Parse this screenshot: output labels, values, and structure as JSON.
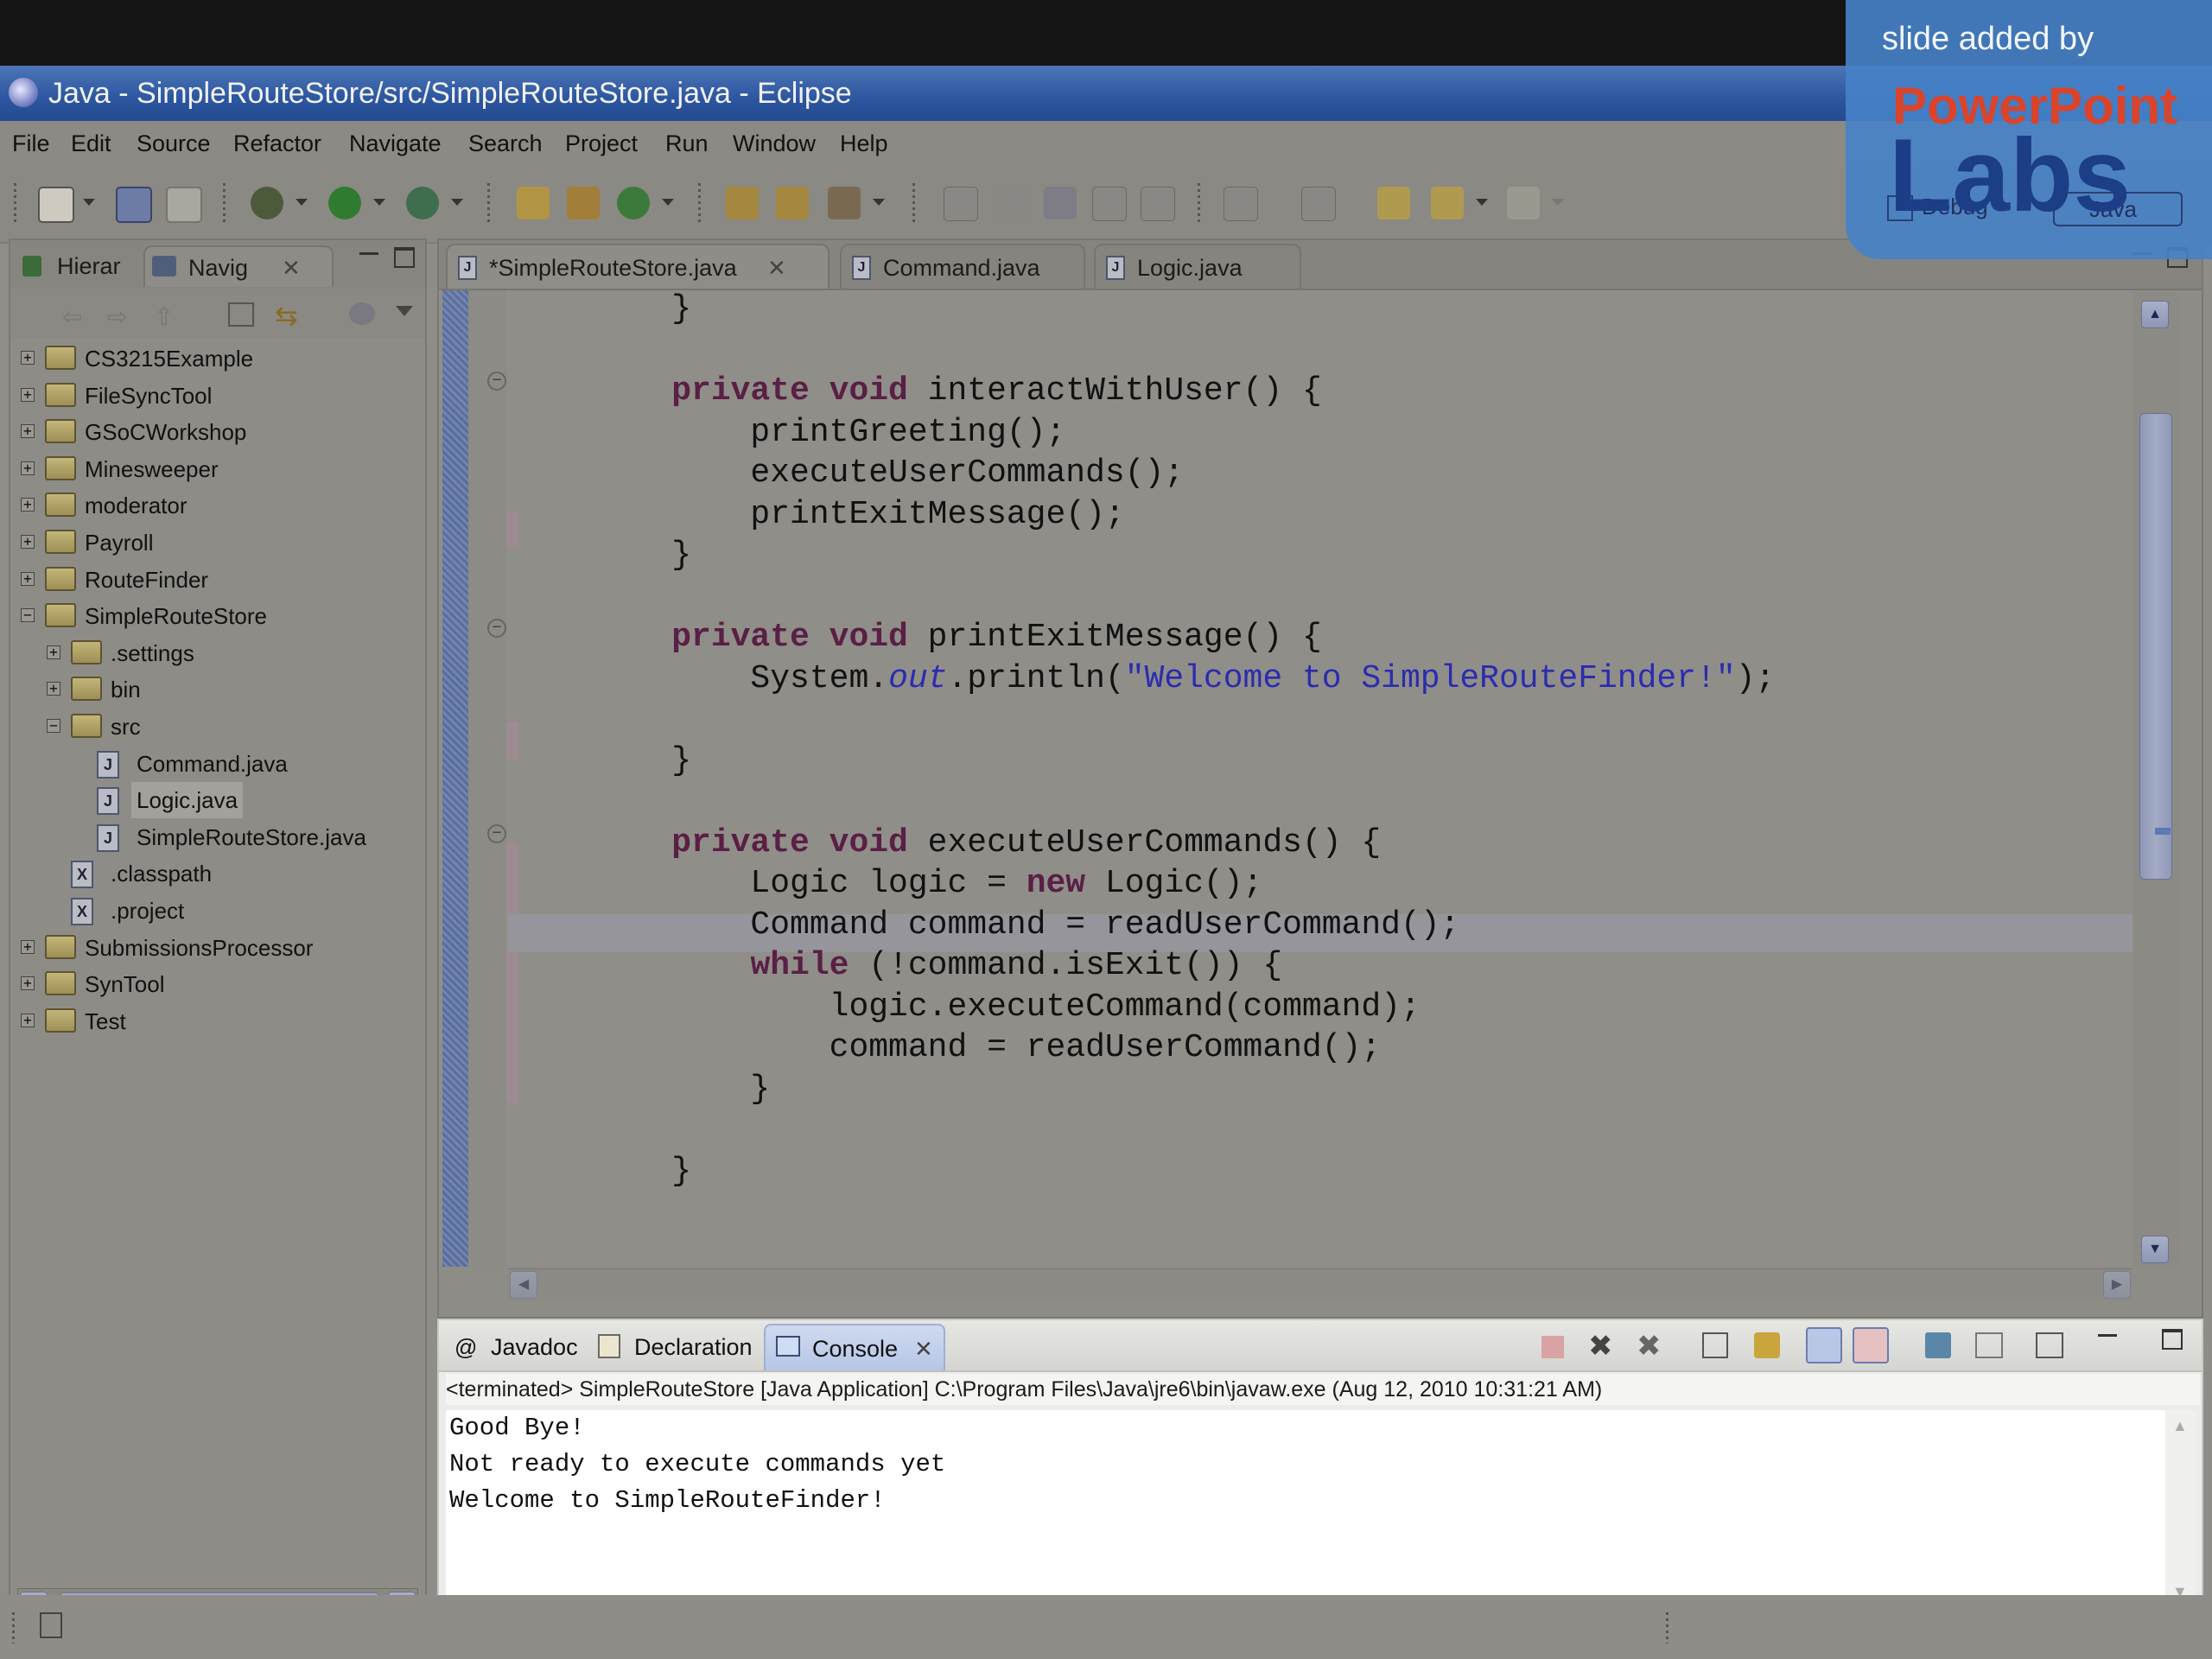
{
  "window": {
    "title": "Java - SimpleRouteStore/src/SimpleRouteStore.java - Eclipse"
  },
  "menu": [
    "File",
    "Edit",
    "Source",
    "Refactor",
    "Navigate",
    "Search",
    "Project",
    "Run",
    "Window",
    "Help"
  ],
  "left_panel": {
    "tabs": [
      {
        "label": "Hierar",
        "icon": "hierarchy-icon"
      },
      {
        "label": "Navig",
        "icon": "navigator-icon"
      }
    ],
    "tree": [
      {
        "label": "CS3215Example",
        "type": "project",
        "expanded": false
      },
      {
        "label": "FileSyncTool",
        "type": "project",
        "expanded": false
      },
      {
        "label": "GSoCWorkshop",
        "type": "project",
        "expanded": false
      },
      {
        "label": "Minesweeper",
        "type": "project",
        "expanded": false
      },
      {
        "label": "moderator",
        "type": "project",
        "expanded": false
      },
      {
        "label": "Payroll",
        "type": "project",
        "expanded": false
      },
      {
        "label": "RouteFinder",
        "type": "project",
        "expanded": false
      },
      {
        "label": "SimpleRouteStore",
        "type": "project",
        "expanded": true
      },
      {
        "label": ".settings",
        "type": "folder",
        "expanded": false
      },
      {
        "label": "bin",
        "type": "folder",
        "expanded": false
      },
      {
        "label": "src",
        "type": "folder",
        "expanded": true
      },
      {
        "label": "Command.java",
        "type": "java"
      },
      {
        "label": "Logic.java",
        "type": "java",
        "selected": true
      },
      {
        "label": "SimpleRouteStore.java",
        "type": "java"
      },
      {
        "label": ".classpath",
        "type": "xml"
      },
      {
        "label": ".project",
        "type": "xml"
      },
      {
        "label": "SubmissionsProcessor",
        "type": "project",
        "expanded": false
      },
      {
        "label": "SynTool",
        "type": "project",
        "expanded": false
      },
      {
        "label": "Test",
        "type": "project",
        "expanded": false
      }
    ]
  },
  "editor": {
    "tabs": [
      {
        "label": "*SimpleRouteStore.java",
        "active": true
      },
      {
        "label": "Command.java",
        "active": false
      },
      {
        "label": "Logic.java",
        "active": false
      }
    ],
    "code": [
      [
        {
          "t": "    }"
        }
      ],
      [
        {
          "t": ""
        }
      ],
      [
        {
          "t": "    "
        },
        {
          "t": "private void",
          "k": "kw"
        },
        {
          "t": " interactWithUser() {"
        }
      ],
      [
        {
          "t": "        printGreeting();"
        }
      ],
      [
        {
          "t": "        executeUserCommands();"
        }
      ],
      [
        {
          "t": "        printExitMessage();"
        }
      ],
      [
        {
          "t": "    }"
        }
      ],
      [
        {
          "t": ""
        }
      ],
      [
        {
          "t": "    "
        },
        {
          "t": "private void",
          "k": "kw"
        },
        {
          "t": " printExitMessage() {"
        }
      ],
      [
        {
          "t": "        System."
        },
        {
          "t": "out",
          "k": "fld"
        },
        {
          "t": ".println("
        },
        {
          "t": "\"Welcome to SimpleRouteFinder!\"",
          "k": "str"
        },
        {
          "t": ");"
        }
      ],
      [
        {
          "t": ""
        }
      ],
      [
        {
          "t": "    }"
        }
      ],
      [
        {
          "t": ""
        }
      ],
      [
        {
          "t": "    "
        },
        {
          "t": "private void",
          "k": "kw"
        },
        {
          "t": " executeUserCommands() {"
        }
      ],
      [
        {
          "t": "        Logic logic = "
        },
        {
          "t": "new",
          "k": "kw"
        },
        {
          "t": " Logic();"
        }
      ],
      [
        {
          "t": "        Command command = readUserCommand();"
        }
      ],
      [
        {
          "t": "        "
        },
        {
          "t": "while",
          "k": "kw"
        },
        {
          "t": " (!command.isExit()) {"
        }
      ],
      [
        {
          "t": "            logic.executeCommand(command);"
        }
      ],
      [
        {
          "t": "            command = readUserCommand();"
        }
      ],
      [
        {
          "t": "        }"
        }
      ],
      [
        {
          "t": ""
        }
      ],
      [
        {
          "t": "    }"
        }
      ]
    ]
  },
  "console": {
    "tabs": [
      {
        "label": "Javadoc",
        "icon": "at-icon"
      },
      {
        "label": "Declaration",
        "icon": "declaration-icon"
      },
      {
        "label": "Console",
        "icon": "console-icon",
        "active": true
      }
    ],
    "status": "<terminated> SimpleRouteStore [Java Application] C:\\Program Files\\Java\\jre6\\bin\\javaw.exe (Aug 12, 2010 10:31:21 AM)",
    "output": [
      "Good Bye!",
      "Not ready to execute commands yet",
      "Welcome to SimpleRouteFinder!"
    ]
  },
  "perspectives": [
    "Debug",
    "Java"
  ],
  "watermark": {
    "caption": "slide added by",
    "brand_top": "PowerPoint",
    "brand_bottom": "Labs"
  },
  "colors": {
    "titlebar": "#2c56a0",
    "keyword": "#5a1f45",
    "string": "#2b2cae",
    "watermark": "#4682c8"
  }
}
